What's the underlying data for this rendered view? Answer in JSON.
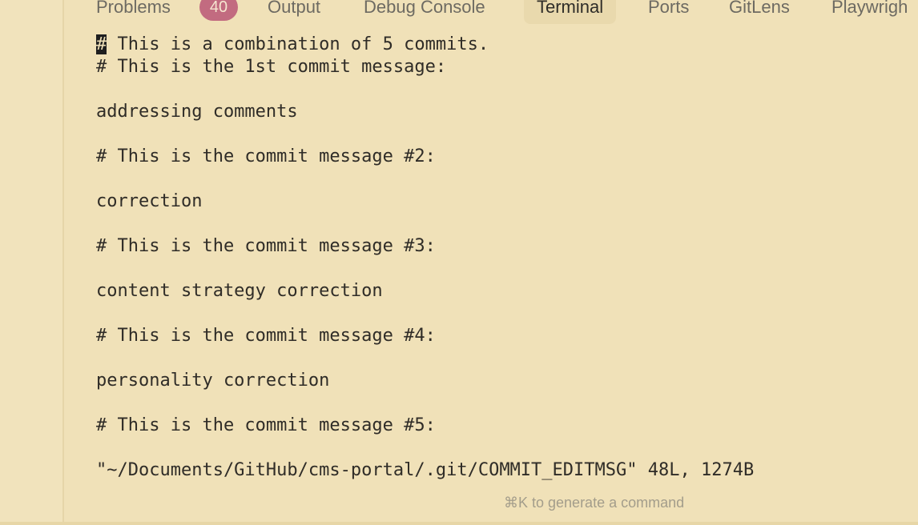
{
  "tabs": [
    {
      "label": "Problems",
      "badge": "40"
    },
    {
      "label": "Output"
    },
    {
      "label": "Debug Console"
    },
    {
      "label": "Terminal",
      "active": true
    },
    {
      "label": "Ports"
    },
    {
      "label": "GitLens"
    },
    {
      "label": "Playwrigh"
    }
  ],
  "terminal": {
    "lines": [
      "# This is a combination of 5 commits.",
      "# This is the 1st commit message:",
      "",
      "addressing comments",
      "",
      "# This is the commit message #2:",
      "",
      "correction",
      "",
      "# This is the commit message #3:",
      "",
      "content strategy correction",
      "",
      "# This is the commit message #4:",
      "",
      "personality correction",
      "",
      "# This is the commit message #5:",
      "",
      "\"~/Documents/GitHub/cms-portal/.git/COMMIT_EDITMSG\" 48L, 1274B"
    ],
    "cursor_char": "#",
    "first_line_rest": " This is a combination of 5 commits."
  },
  "hint": "⌘K to generate a command",
  "colors": {
    "background": "#f0e1b8",
    "badge": "#c26b80",
    "active_tab": "#e9d9ad",
    "text": "#2f2c27"
  }
}
